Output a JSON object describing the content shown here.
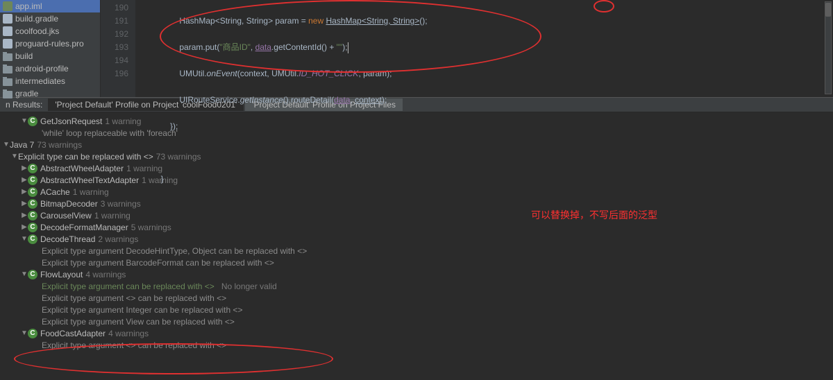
{
  "sidebar": {
    "files": [
      {
        "label": "app.iml",
        "iconClass": "ico-file"
      },
      {
        "label": "build.gradle",
        "iconClass": "ico-jks"
      },
      {
        "label": "coolfood.jks",
        "iconClass": "ico-jks"
      },
      {
        "label": "proguard-rules.pro",
        "iconClass": "ico-txt"
      },
      {
        "label": "build",
        "iconClass": "ico-dir2"
      },
      {
        "label": "android-profile",
        "iconClass": "ico-dir2"
      },
      {
        "label": "intermediates",
        "iconClass": "ico-dir2"
      },
      {
        "label": "gradle",
        "iconClass": "ico-dir2"
      }
    ]
  },
  "editor": {
    "lineNumbers": [
      "190",
      "191",
      "192",
      "193",
      "194",
      " ",
      "196"
    ],
    "line190": {
      "indent": "                ",
      "type1": "HashMap",
      "gen1": "<String, String>",
      "var": " param = ",
      "newKw": "new",
      "sp": " ",
      "type2": "HashMap",
      "gen2": "<String, String>",
      "end": "();"
    },
    "line191": {
      "indent": "                ",
      "obj": "param.put(",
      "str": "\"商品ID\"",
      "comma": ", ",
      "data": "data",
      "call": ".getContentId() + ",
      "str2": "\"\"",
      "end": ");"
    },
    "line192": {
      "indent": "                ",
      "cls": "UMUtil.",
      "fn": "onEvent",
      "open": "(context, UMUtil.",
      "const": "ID_HOT_CLICK",
      "end": ", param);"
    },
    "line193": {
      "indent": "                ",
      "cls": "UIRouteService.",
      "fn": "getInstance",
      "mid": "().routeDetail(",
      "data": "data",
      "c": ", ",
      "ctx": "context",
      "end": ");"
    },
    "line194": {
      "text": "            });"
    },
    "line196": {
      "text": "        }"
    }
  },
  "tabsRow": {
    "resultsLabel": "n Results:",
    "tab1": "'Project Default' Profile on Project 'coolFood0201'",
    "tab2": "'Project Default' Profile on Project Files"
  },
  "inspect": {
    "r1": {
      "label": "GetJsonRequest",
      "count": "1 warning"
    },
    "r2": {
      "label": "'while' loop replaceable with 'foreach'"
    },
    "r3": {
      "label": "Java 7",
      "count": "73 warnings"
    },
    "r4": {
      "label": "Explicit type can be replaced with <>",
      "count": "73 warnings"
    },
    "r5": {
      "label": "AbstractWheelAdapter",
      "count": "1 warning"
    },
    "r6": {
      "label": "AbstractWheelTextAdapter",
      "count": "1 warning"
    },
    "r7": {
      "label": "ACache",
      "count": "1 warning"
    },
    "r8": {
      "label": "BitmapDecoder",
      "count": "3 warnings"
    },
    "r9": {
      "label": "CarouselView",
      "count": "1 warning"
    },
    "r10": {
      "label": "DecodeFormatManager",
      "count": "5 warnings"
    },
    "r11": {
      "label": "DecodeThread",
      "count": "2 warnings"
    },
    "r12": {
      "label": "Explicit type argument DecodeHintType, Object can be replaced with <>"
    },
    "r13": {
      "label": "Explicit type argument BarcodeFormat can be replaced with <>"
    },
    "r14": {
      "label": "FlowLayout",
      "count": "4 warnings"
    },
    "r15": {
      "label": "Explicit type argument  can be replaced with <>",
      "invalid": "No longer valid"
    },
    "r16": {
      "label": "Explicit type argument <> can be replaced with <>"
    },
    "r17": {
      "label": "Explicit type argument Integer can be replaced with <>"
    },
    "r18": {
      "label": "Explicit type argument View can be replaced with <>"
    },
    "r19": {
      "label": "FoodCastAdapter",
      "count": "4 warnings"
    },
    "r20": {
      "label": "Explicit type argument <> can be replaced with <>"
    }
  },
  "annotations": {
    "sideText": "可以替换掉，不写后面的泛型"
  }
}
